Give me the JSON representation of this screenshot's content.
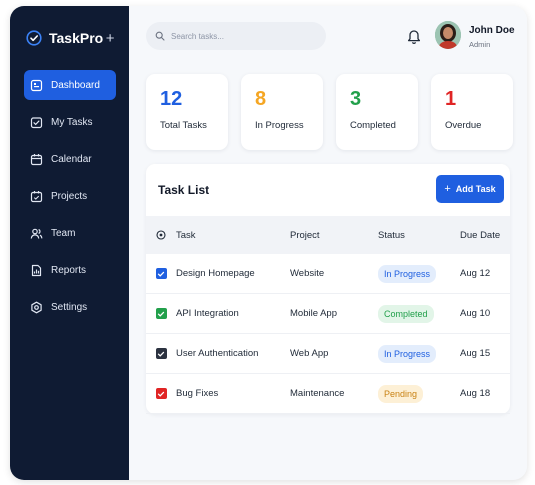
{
  "app": {
    "name": "TaskPro"
  },
  "sidebar": {
    "items": [
      {
        "label": "Dashboard",
        "active": true,
        "icon": "dashboard-icon"
      },
      {
        "label": "My Tasks",
        "active": false,
        "icon": "tasks-icon"
      },
      {
        "label": "Calendar",
        "active": false,
        "icon": "calendar-icon"
      },
      {
        "label": "Projects",
        "active": false,
        "icon": "projects-icon"
      },
      {
        "label": "Team",
        "active": false,
        "icon": "team-icon"
      },
      {
        "label": "Reports",
        "active": false,
        "icon": "reports-icon"
      },
      {
        "label": "Settings",
        "active": false,
        "icon": "settings-icon"
      }
    ]
  },
  "search": {
    "placeholder": "Search tasks..."
  },
  "user": {
    "name": "John Doe",
    "role": "Admin"
  },
  "stats": [
    {
      "value": "12",
      "label": "Total Tasks",
      "color": "#1f5fe0"
    },
    {
      "value": "8",
      "label": "In Progress",
      "color": "#f5a623"
    },
    {
      "value": "3",
      "label": "Completed",
      "color": "#22a04b"
    },
    {
      "value": "1",
      "label": "Overdue",
      "color": "#e02424"
    }
  ],
  "tasks": {
    "title": "Task List",
    "add_label": "Add Task",
    "columns": [
      "Task",
      "Project",
      "Status",
      "Due Date"
    ],
    "rows": [
      {
        "task": "Design Homepage",
        "project": "Website",
        "status": "In Progress",
        "due": "Aug 12",
        "check_color": "#1f5fe0",
        "status_bg": "#e3edfc",
        "status_fg": "#1f5fe0"
      },
      {
        "task": "API Integration",
        "project": "Mobile App",
        "status": "Completed",
        "due": "Aug 10",
        "check_color": "#22a04b",
        "status_bg": "#e2f5e8",
        "status_fg": "#22a04b"
      },
      {
        "task": "User Authentication",
        "project": "Web App",
        "status": "In Progress",
        "due": "Aug 15",
        "check_color": "#2b3240",
        "status_bg": "#e3edfc",
        "status_fg": "#1f5fe0"
      },
      {
        "task": "Bug Fixes",
        "project": "Maintenance",
        "status": "Pending",
        "due": "Aug 18",
        "check_color": "#e02424",
        "status_bg": "#fdf0d6",
        "status_fg": "#c98214"
      }
    ]
  }
}
